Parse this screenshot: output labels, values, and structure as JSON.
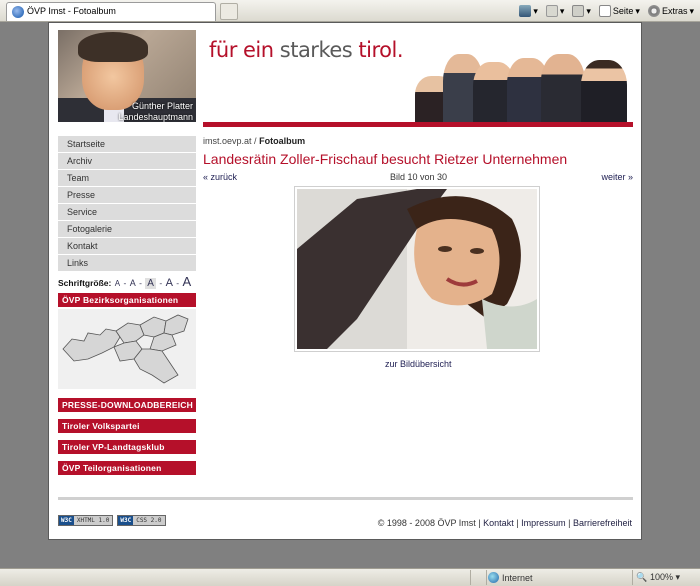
{
  "browser": {
    "tab_title": "ÖVP Imst - Fotoalbum",
    "tools": {
      "page_label": "Seite",
      "extras_label": "Extras"
    },
    "status": {
      "zone_label": "Internet",
      "zoom_label": "100%"
    }
  },
  "header": {
    "slogan_part1": "für ein",
    "slogan_part2": "starkes",
    "slogan_part3": "tirol.",
    "portrait_name": "Günther Platter",
    "portrait_title": "Landeshauptmann"
  },
  "nav": {
    "items": [
      "Startseite",
      "Archiv",
      "Team",
      "Presse",
      "Service",
      "Fotogalerie",
      "Kontakt",
      "Links"
    ]
  },
  "font_size": {
    "label": "Schriftgröße:",
    "sizes": [
      "A",
      "A",
      "A",
      "A",
      "A"
    ],
    "separator": "-"
  },
  "sidebar": {
    "bezirk_label": "ÖVP Bezirksorganisationen",
    "links": [
      "PRESSE-DOWNLOADBEREICH",
      "Tiroler Volkspartei",
      "Tiroler VP-Landtagsklub",
      "ÖVP Teilorganisationen"
    ]
  },
  "main": {
    "breadcrumb_site": "imst.oevp.at",
    "breadcrumb_sep": "/",
    "breadcrumb_page": "Fotoalbum",
    "headline": "Landesrätin Zoller-Frischauf besucht Rietzer Unternehmen",
    "pager_back": "« zurück",
    "pager_counter": "Bild 10 von 30",
    "pager_next": "weiter »",
    "overview_link": "zur Bildübersicht"
  },
  "footer": {
    "badge1_w3": "W3C",
    "badge1_label": "XHTML 1.0",
    "badge2_w3": "W3C",
    "badge2_label": "CSS 2.0",
    "copyright": "© 1998 - 2008 ÖVP Imst",
    "sep": "|",
    "links": [
      "Kontakt",
      "Impressum",
      "Barrierefreiheit"
    ]
  },
  "colors": {
    "brand_red": "#b5102a",
    "nav_gray": "#dcdcdc"
  }
}
